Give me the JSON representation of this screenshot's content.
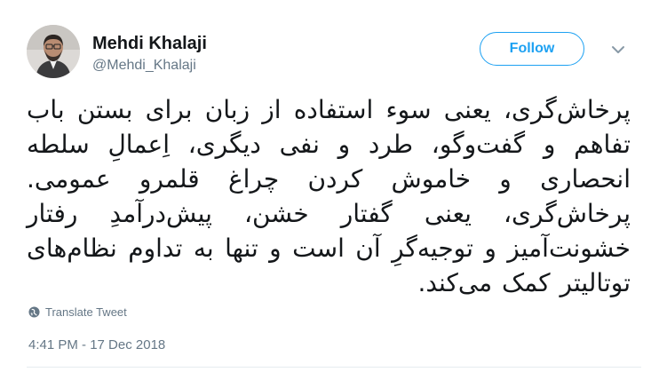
{
  "author": {
    "display_name": "Mehdi Khalaji",
    "handle": "@Mehdi_Khalaji"
  },
  "follow_label": "Follow",
  "tweet": {
    "text": "پرخاش‌گری، یعنی سوء استفاده از زبان برای بستن باب تفاهم و گفت‌وگو، طرد و نفی دیگری، اِعمالِ سلطه انحصاری و خاموش کردن چراغ قلمرو عمومی. پرخاش‌گری، یعنی گفتار خشن، پیش‌درآمدِ رفتار خشونت‌آمیز و توجیه‌گرِ آن است و تنها به تداوم نظام‌های توتالیتر کمک می‌کند."
  },
  "translate_label": "Translate Tweet",
  "timestamp": "4:41 PM - 17 Dec 2018",
  "colors": {
    "accent": "#1da1f2",
    "secondary_text": "#657786",
    "primary_text": "#14171a"
  },
  "icons": {
    "menu": "chevron-down-icon",
    "translate": "globe-icon"
  }
}
